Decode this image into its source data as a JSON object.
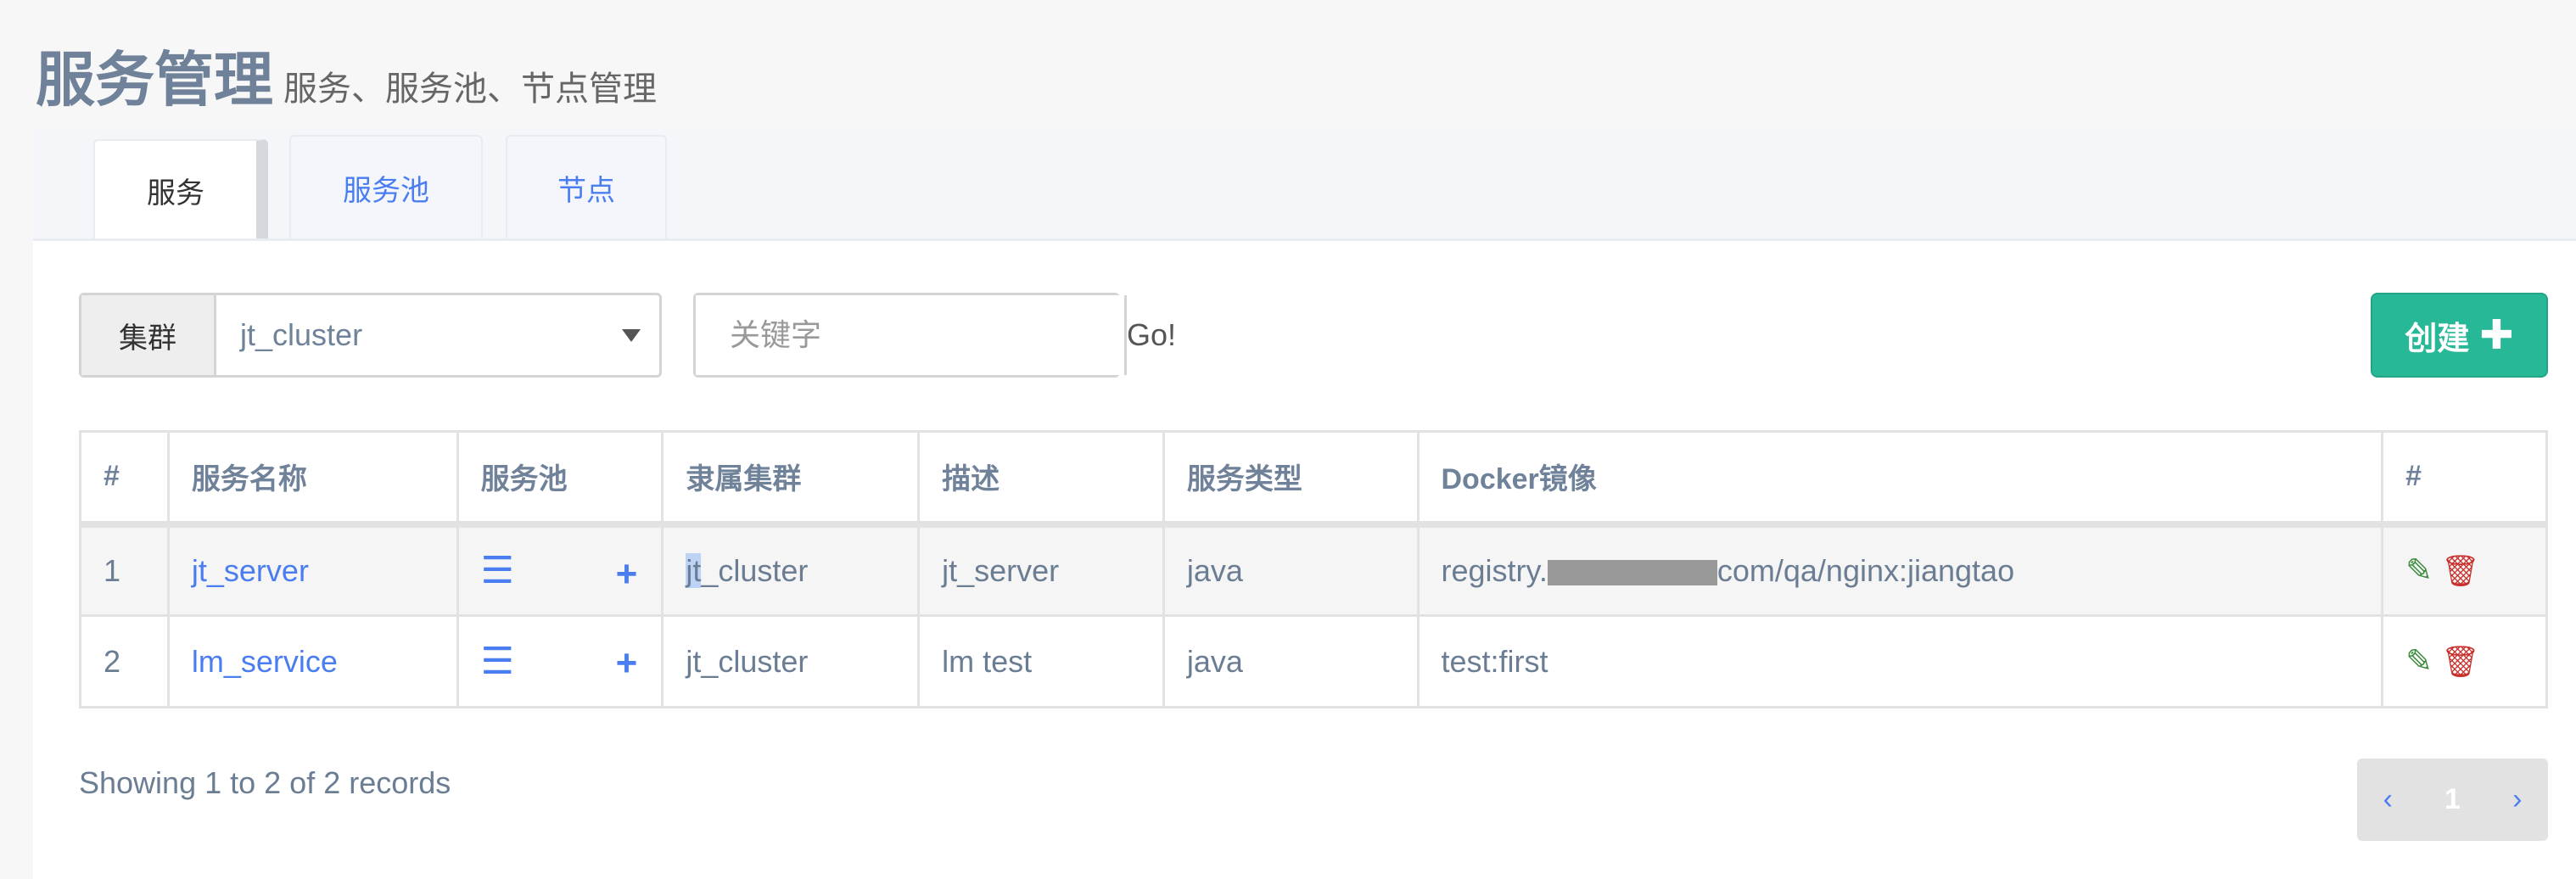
{
  "header": {
    "title": "服务管理",
    "subtitle": "服务、服务池、节点管理"
  },
  "tabs": [
    {
      "label": "服务",
      "active": true
    },
    {
      "label": "服务池"
    },
    {
      "label": "节点"
    }
  ],
  "filter": {
    "cluster_label": "集群",
    "cluster_value": "jt_cluster",
    "keyword_placeholder": "关键字",
    "go_label": "Go!"
  },
  "create_label": "创建",
  "table": {
    "columns": [
      "#",
      "服务名称",
      "服务池",
      "隶属集群",
      "描述",
      "服务类型",
      "Docker镜像",
      "#"
    ],
    "rows": [
      {
        "index": "1",
        "name": "jt_server",
        "cluster_sel": "jt",
        "cluster_rest": "_cluster",
        "desc": "jt_server",
        "type": "java",
        "image_pre": "registry.",
        "image_post": "com/qa/nginx:jiangtao"
      },
      {
        "index": "2",
        "name": "lm_service",
        "cluster": "jt_cluster",
        "desc": "lm test",
        "type": "java",
        "image": "test:first"
      }
    ]
  },
  "footer": {
    "summary": "Showing 1 to 2 of 2 records",
    "page": "1",
    "prev": "‹",
    "next": "›"
  },
  "colors": {
    "accent": "#27b898",
    "link": "#4a7ef0",
    "edit": "#3c8c3c",
    "delete": "#c9302c"
  }
}
